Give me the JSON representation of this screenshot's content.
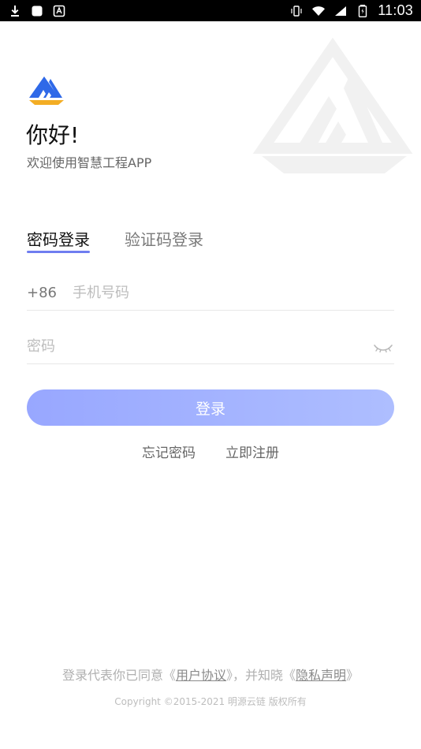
{
  "status_bar": {
    "time": "11:03"
  },
  "brand": {
    "greeting": "你好!",
    "subtitle": "欢迎使用智慧工程APP"
  },
  "tabs": [
    {
      "label": "密码登录"
    },
    {
      "label": "验证码登录"
    }
  ],
  "form": {
    "country_code": "+86",
    "phone_placeholder": "手机号码",
    "password_placeholder": "密码"
  },
  "login_button": {
    "label": "登录"
  },
  "links": {
    "forgot_password": "忘记密码",
    "register": "立即注册"
  },
  "footer": {
    "agreement_prefix": "登录代表你已同意《",
    "user_agreement": "用户协议",
    "agreement_middle": "》，并知晓《",
    "privacy_policy": "隐私声明",
    "agreement_suffix": "》",
    "copyright": "Copyright ©2015-2021 明源云链 版权所有"
  },
  "colors": {
    "primary": "#6f7df0",
    "button_gradient_start": "#98a7ff",
    "button_gradient_end": "#aebeff"
  },
  "icons": {
    "download": "download-icon",
    "square": "square-icon",
    "app_notification": "app-notification-icon",
    "vibrate": "vibrate-icon",
    "wifi": "wifi-icon",
    "signal": "signal-icon",
    "battery": "battery-icon",
    "logo": "app-logo",
    "eye": "eye-closed-icon"
  }
}
